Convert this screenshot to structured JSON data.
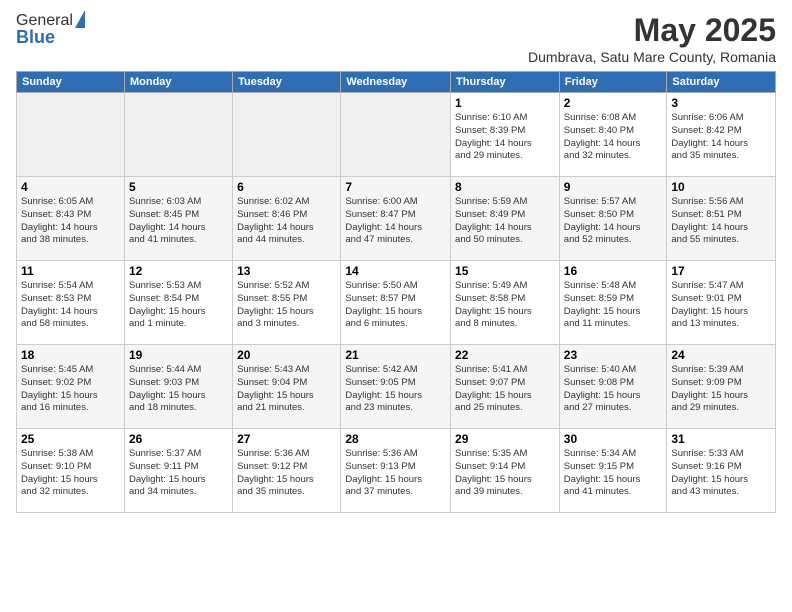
{
  "header": {
    "logo_general": "General",
    "logo_blue": "Blue",
    "month_year": "May 2025",
    "location": "Dumbrava, Satu Mare County, Romania"
  },
  "days_of_week": [
    "Sunday",
    "Monday",
    "Tuesday",
    "Wednesday",
    "Thursday",
    "Friday",
    "Saturday"
  ],
  "weeks": [
    [
      {
        "day": "",
        "info": ""
      },
      {
        "day": "",
        "info": ""
      },
      {
        "day": "",
        "info": ""
      },
      {
        "day": "",
        "info": ""
      },
      {
        "day": "1",
        "info": "Sunrise: 6:10 AM\nSunset: 8:39 PM\nDaylight: 14 hours\nand 29 minutes."
      },
      {
        "day": "2",
        "info": "Sunrise: 6:08 AM\nSunset: 8:40 PM\nDaylight: 14 hours\nand 32 minutes."
      },
      {
        "day": "3",
        "info": "Sunrise: 6:06 AM\nSunset: 8:42 PM\nDaylight: 14 hours\nand 35 minutes."
      }
    ],
    [
      {
        "day": "4",
        "info": "Sunrise: 6:05 AM\nSunset: 8:43 PM\nDaylight: 14 hours\nand 38 minutes."
      },
      {
        "day": "5",
        "info": "Sunrise: 6:03 AM\nSunset: 8:45 PM\nDaylight: 14 hours\nand 41 minutes."
      },
      {
        "day": "6",
        "info": "Sunrise: 6:02 AM\nSunset: 8:46 PM\nDaylight: 14 hours\nand 44 minutes."
      },
      {
        "day": "7",
        "info": "Sunrise: 6:00 AM\nSunset: 8:47 PM\nDaylight: 14 hours\nand 47 minutes."
      },
      {
        "day": "8",
        "info": "Sunrise: 5:59 AM\nSunset: 8:49 PM\nDaylight: 14 hours\nand 50 minutes."
      },
      {
        "day": "9",
        "info": "Sunrise: 5:57 AM\nSunset: 8:50 PM\nDaylight: 14 hours\nand 52 minutes."
      },
      {
        "day": "10",
        "info": "Sunrise: 5:56 AM\nSunset: 8:51 PM\nDaylight: 14 hours\nand 55 minutes."
      }
    ],
    [
      {
        "day": "11",
        "info": "Sunrise: 5:54 AM\nSunset: 8:53 PM\nDaylight: 14 hours\nand 58 minutes."
      },
      {
        "day": "12",
        "info": "Sunrise: 5:53 AM\nSunset: 8:54 PM\nDaylight: 15 hours\nand 1 minute."
      },
      {
        "day": "13",
        "info": "Sunrise: 5:52 AM\nSunset: 8:55 PM\nDaylight: 15 hours\nand 3 minutes."
      },
      {
        "day": "14",
        "info": "Sunrise: 5:50 AM\nSunset: 8:57 PM\nDaylight: 15 hours\nand 6 minutes."
      },
      {
        "day": "15",
        "info": "Sunrise: 5:49 AM\nSunset: 8:58 PM\nDaylight: 15 hours\nand 8 minutes."
      },
      {
        "day": "16",
        "info": "Sunrise: 5:48 AM\nSunset: 8:59 PM\nDaylight: 15 hours\nand 11 minutes."
      },
      {
        "day": "17",
        "info": "Sunrise: 5:47 AM\nSunset: 9:01 PM\nDaylight: 15 hours\nand 13 minutes."
      }
    ],
    [
      {
        "day": "18",
        "info": "Sunrise: 5:45 AM\nSunset: 9:02 PM\nDaylight: 15 hours\nand 16 minutes."
      },
      {
        "day": "19",
        "info": "Sunrise: 5:44 AM\nSunset: 9:03 PM\nDaylight: 15 hours\nand 18 minutes."
      },
      {
        "day": "20",
        "info": "Sunrise: 5:43 AM\nSunset: 9:04 PM\nDaylight: 15 hours\nand 21 minutes."
      },
      {
        "day": "21",
        "info": "Sunrise: 5:42 AM\nSunset: 9:05 PM\nDaylight: 15 hours\nand 23 minutes."
      },
      {
        "day": "22",
        "info": "Sunrise: 5:41 AM\nSunset: 9:07 PM\nDaylight: 15 hours\nand 25 minutes."
      },
      {
        "day": "23",
        "info": "Sunrise: 5:40 AM\nSunset: 9:08 PM\nDaylight: 15 hours\nand 27 minutes."
      },
      {
        "day": "24",
        "info": "Sunrise: 5:39 AM\nSunset: 9:09 PM\nDaylight: 15 hours\nand 29 minutes."
      }
    ],
    [
      {
        "day": "25",
        "info": "Sunrise: 5:38 AM\nSunset: 9:10 PM\nDaylight: 15 hours\nand 32 minutes."
      },
      {
        "day": "26",
        "info": "Sunrise: 5:37 AM\nSunset: 9:11 PM\nDaylight: 15 hours\nand 34 minutes."
      },
      {
        "day": "27",
        "info": "Sunrise: 5:36 AM\nSunset: 9:12 PM\nDaylight: 15 hours\nand 35 minutes."
      },
      {
        "day": "28",
        "info": "Sunrise: 5:36 AM\nSunset: 9:13 PM\nDaylight: 15 hours\nand 37 minutes."
      },
      {
        "day": "29",
        "info": "Sunrise: 5:35 AM\nSunset: 9:14 PM\nDaylight: 15 hours\nand 39 minutes."
      },
      {
        "day": "30",
        "info": "Sunrise: 5:34 AM\nSunset: 9:15 PM\nDaylight: 15 hours\nand 41 minutes."
      },
      {
        "day": "31",
        "info": "Sunrise: 5:33 AM\nSunset: 9:16 PM\nDaylight: 15 hours\nand 43 minutes."
      }
    ]
  ]
}
